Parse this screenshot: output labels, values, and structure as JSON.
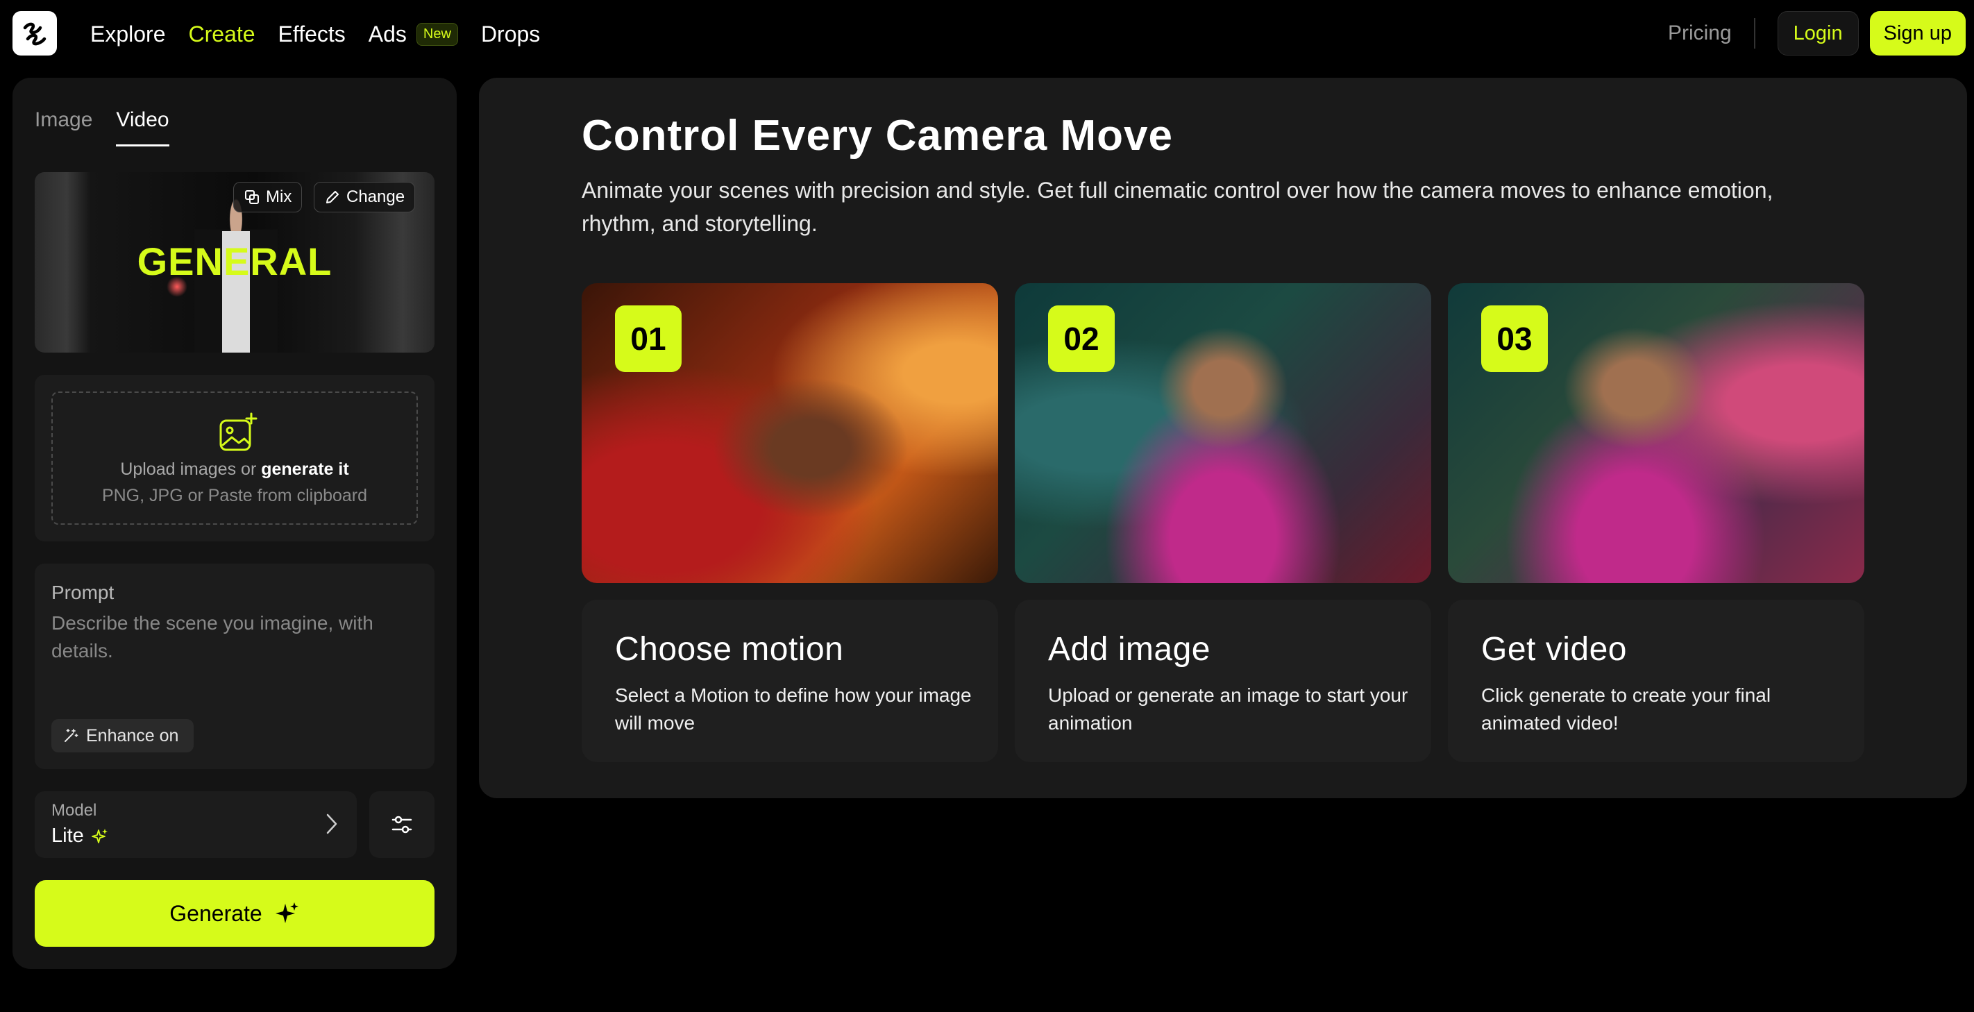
{
  "nav": {
    "items": [
      {
        "label": "Explore"
      },
      {
        "label": "Create"
      },
      {
        "label": "Effects"
      },
      {
        "label": "Ads"
      },
      {
        "label": "Drops"
      }
    ],
    "ads_badge": "New",
    "pricing": "Pricing",
    "login": "Login",
    "signup": "Sign up"
  },
  "left": {
    "tabs": [
      {
        "label": "Image"
      },
      {
        "label": "Video"
      }
    ],
    "preview": {
      "overlay_text": "GENERAL",
      "mix_label": "Mix",
      "change_label": "Change"
    },
    "upload": {
      "prefix": "Upload images or ",
      "link": "generate it",
      "formats": "PNG, JPG or Paste from clipboard"
    },
    "prompt": {
      "label": "Prompt",
      "placeholder": "Describe the scene you imagine, with details.",
      "enhance_label": "Enhance on"
    },
    "model": {
      "label": "Model",
      "value": "Lite"
    },
    "generate_label": "Generate"
  },
  "main": {
    "title": "Control Every Camera Move",
    "description": "Animate your scenes with precision and style. Get full cinematic control over how the camera moves to enhance emotion, rhythm, and storytelling.",
    "steps": [
      {
        "number": "01",
        "title": "Choose motion",
        "description": "Select a Motion to define how your image will move"
      },
      {
        "number": "02",
        "title": "Add image",
        "description": "Upload or generate an image to start your animation"
      },
      {
        "number": "03",
        "title": "Get video",
        "description": "Click generate to create your final animated video!"
      }
    ]
  },
  "colors": {
    "accent": "#d6fb1a",
    "background": "#000000",
    "panel": "#141414",
    "main_panel": "#1a1a1a"
  }
}
